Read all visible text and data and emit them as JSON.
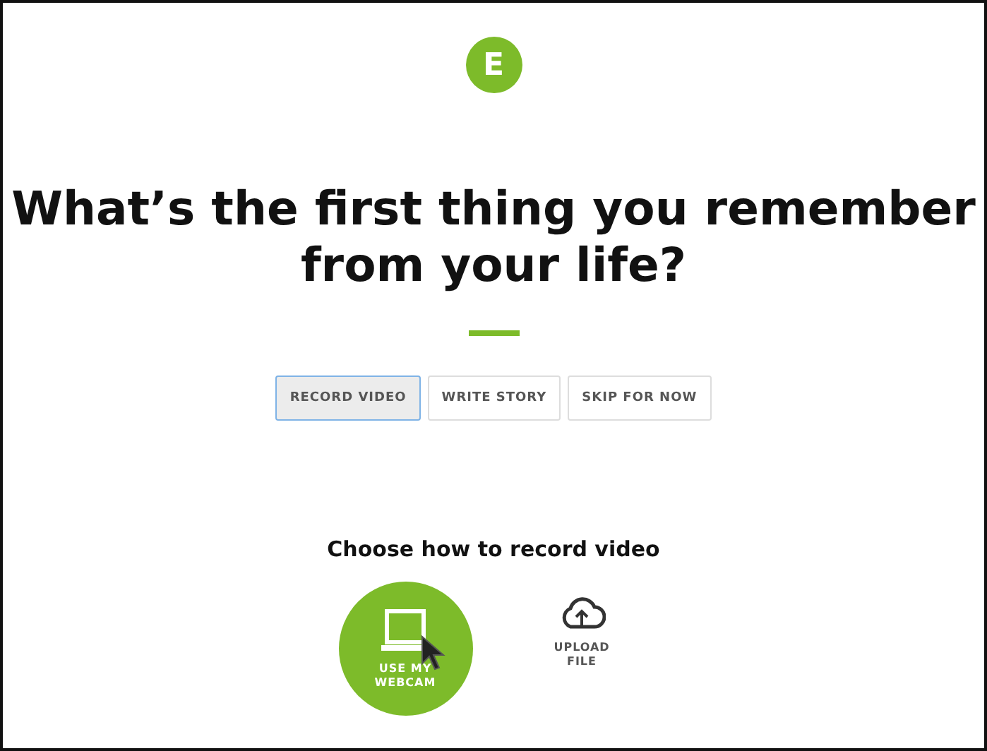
{
  "logo": "E",
  "question": "What’s the first thing you remember from your life?",
  "tabs": [
    {
      "label": "RECORD VIDEO",
      "selected": true
    },
    {
      "label": "WRITE STORY",
      "selected": false
    },
    {
      "label": "SKIP FOR NOW",
      "selected": false
    }
  ],
  "prompt": "Choose how to record video",
  "options": [
    {
      "kind": "webcam",
      "label": "USE MY WEBCAM",
      "selected": true
    },
    {
      "kind": "upload",
      "label": "UPLOAD FILE",
      "selected": false
    }
  ]
}
